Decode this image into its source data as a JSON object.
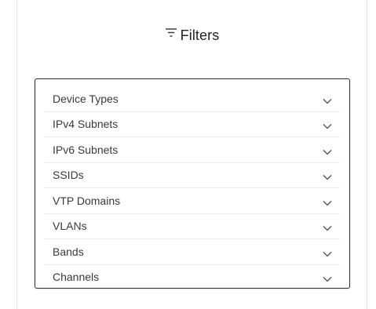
{
  "header": {
    "title": "Filters",
    "icon": "filter-icon"
  },
  "filters": [
    {
      "label": "Device Types",
      "icon": "chevron-down-icon"
    },
    {
      "label": "IPv4 Subnets",
      "icon": "chevron-down-icon"
    },
    {
      "label": "IPv6 Subnets",
      "icon": "chevron-down-icon"
    },
    {
      "label": "SSIDs",
      "icon": "chevron-down-icon"
    },
    {
      "label": "VTP Domains",
      "icon": "chevron-down-icon"
    },
    {
      "label": "VLANs",
      "icon": "chevron-down-icon"
    },
    {
      "label": "Bands",
      "icon": "chevron-down-icon"
    },
    {
      "label": "Channels",
      "icon": "chevron-down-icon"
    }
  ],
  "colors": {
    "text": "#3a3a3a",
    "border": "#2b2b2b",
    "divider": "#ececec"
  }
}
